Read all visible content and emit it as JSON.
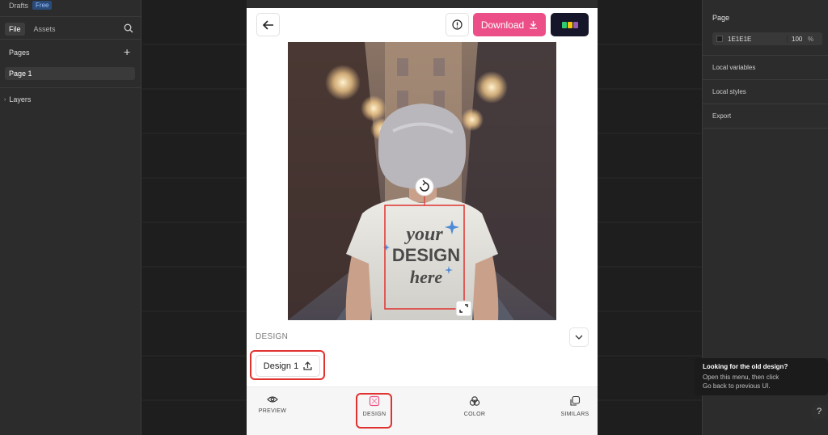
{
  "left_panel": {
    "drafts_label": "Drafts",
    "plan_badge": "Free",
    "tabs": [
      "File",
      "Assets"
    ],
    "pages_heading": "Pages",
    "page_items": [
      "Page 1"
    ],
    "layers_heading": "Layers"
  },
  "right_panel": {
    "page_heading": "Page",
    "background_hex": "1E1E1E",
    "background_opacity": "100",
    "opacity_unit": "%",
    "sections": [
      "Local variables",
      "Local styles",
      "Export"
    ]
  },
  "tooltip": {
    "title": "Looking for the old design?",
    "line1": "Open this menu, then click",
    "line2": "Go back to previous UI."
  },
  "help_label": "?",
  "plugin": {
    "download_label": "Download",
    "artwork_text": {
      "line1": "your",
      "line2": "DESIGN",
      "line3": "here"
    },
    "design_section_title": "DESIGN",
    "design_items": [
      "Design 1"
    ],
    "nav": {
      "preview": "PREVIEW",
      "design": "DESIGN",
      "color": "COLOR",
      "similars": "SIMILARS"
    }
  },
  "colors": {
    "accent_pink": "#ec4f87",
    "highlight_red": "#e0322f",
    "canvas_bg": "#1e1e1e",
    "panel_bg": "#2c2c2c"
  }
}
